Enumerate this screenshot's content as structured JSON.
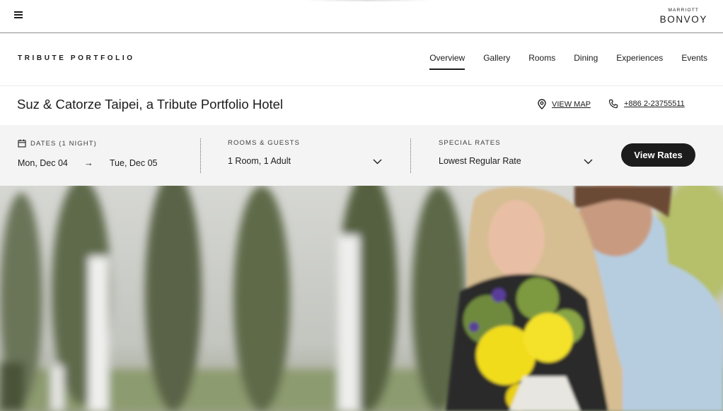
{
  "header": {
    "menu_icon": "hamburger-menu-icon",
    "bonvoy_small": "MARRIOTT",
    "bonvoy_big": "BONVOY"
  },
  "brand": {
    "name": "TRIBUTE PORTFOLIO"
  },
  "nav": {
    "items": [
      {
        "label": "Overview",
        "active": true
      },
      {
        "label": "Gallery"
      },
      {
        "label": "Rooms"
      },
      {
        "label": "Dining"
      },
      {
        "label": "Experiences"
      },
      {
        "label": "Events"
      }
    ]
  },
  "hotel": {
    "title": "Suz & Catorze Taipei, a Tribute Portfolio Hotel",
    "map_label": "VIEW MAP",
    "phone": "+886 2-23755511"
  },
  "booking": {
    "dates_label": "DATES (1 NIGHT)",
    "check_in": "Mon, Dec 04",
    "arrow": "→",
    "check_out": "Tue, Dec 05",
    "rooms_label": "ROOMS & GUESTS",
    "rooms_value": "1 Room, 1 Adult",
    "rates_label": "SPECIAL RATES",
    "rates_value": "Lowest Regular Rate",
    "view_rates": "View Rates"
  },
  "colors": {
    "dark": "#1c1c1c",
    "booking_bg": "#f4f4f4",
    "button_bg": "#1c1c1c"
  }
}
